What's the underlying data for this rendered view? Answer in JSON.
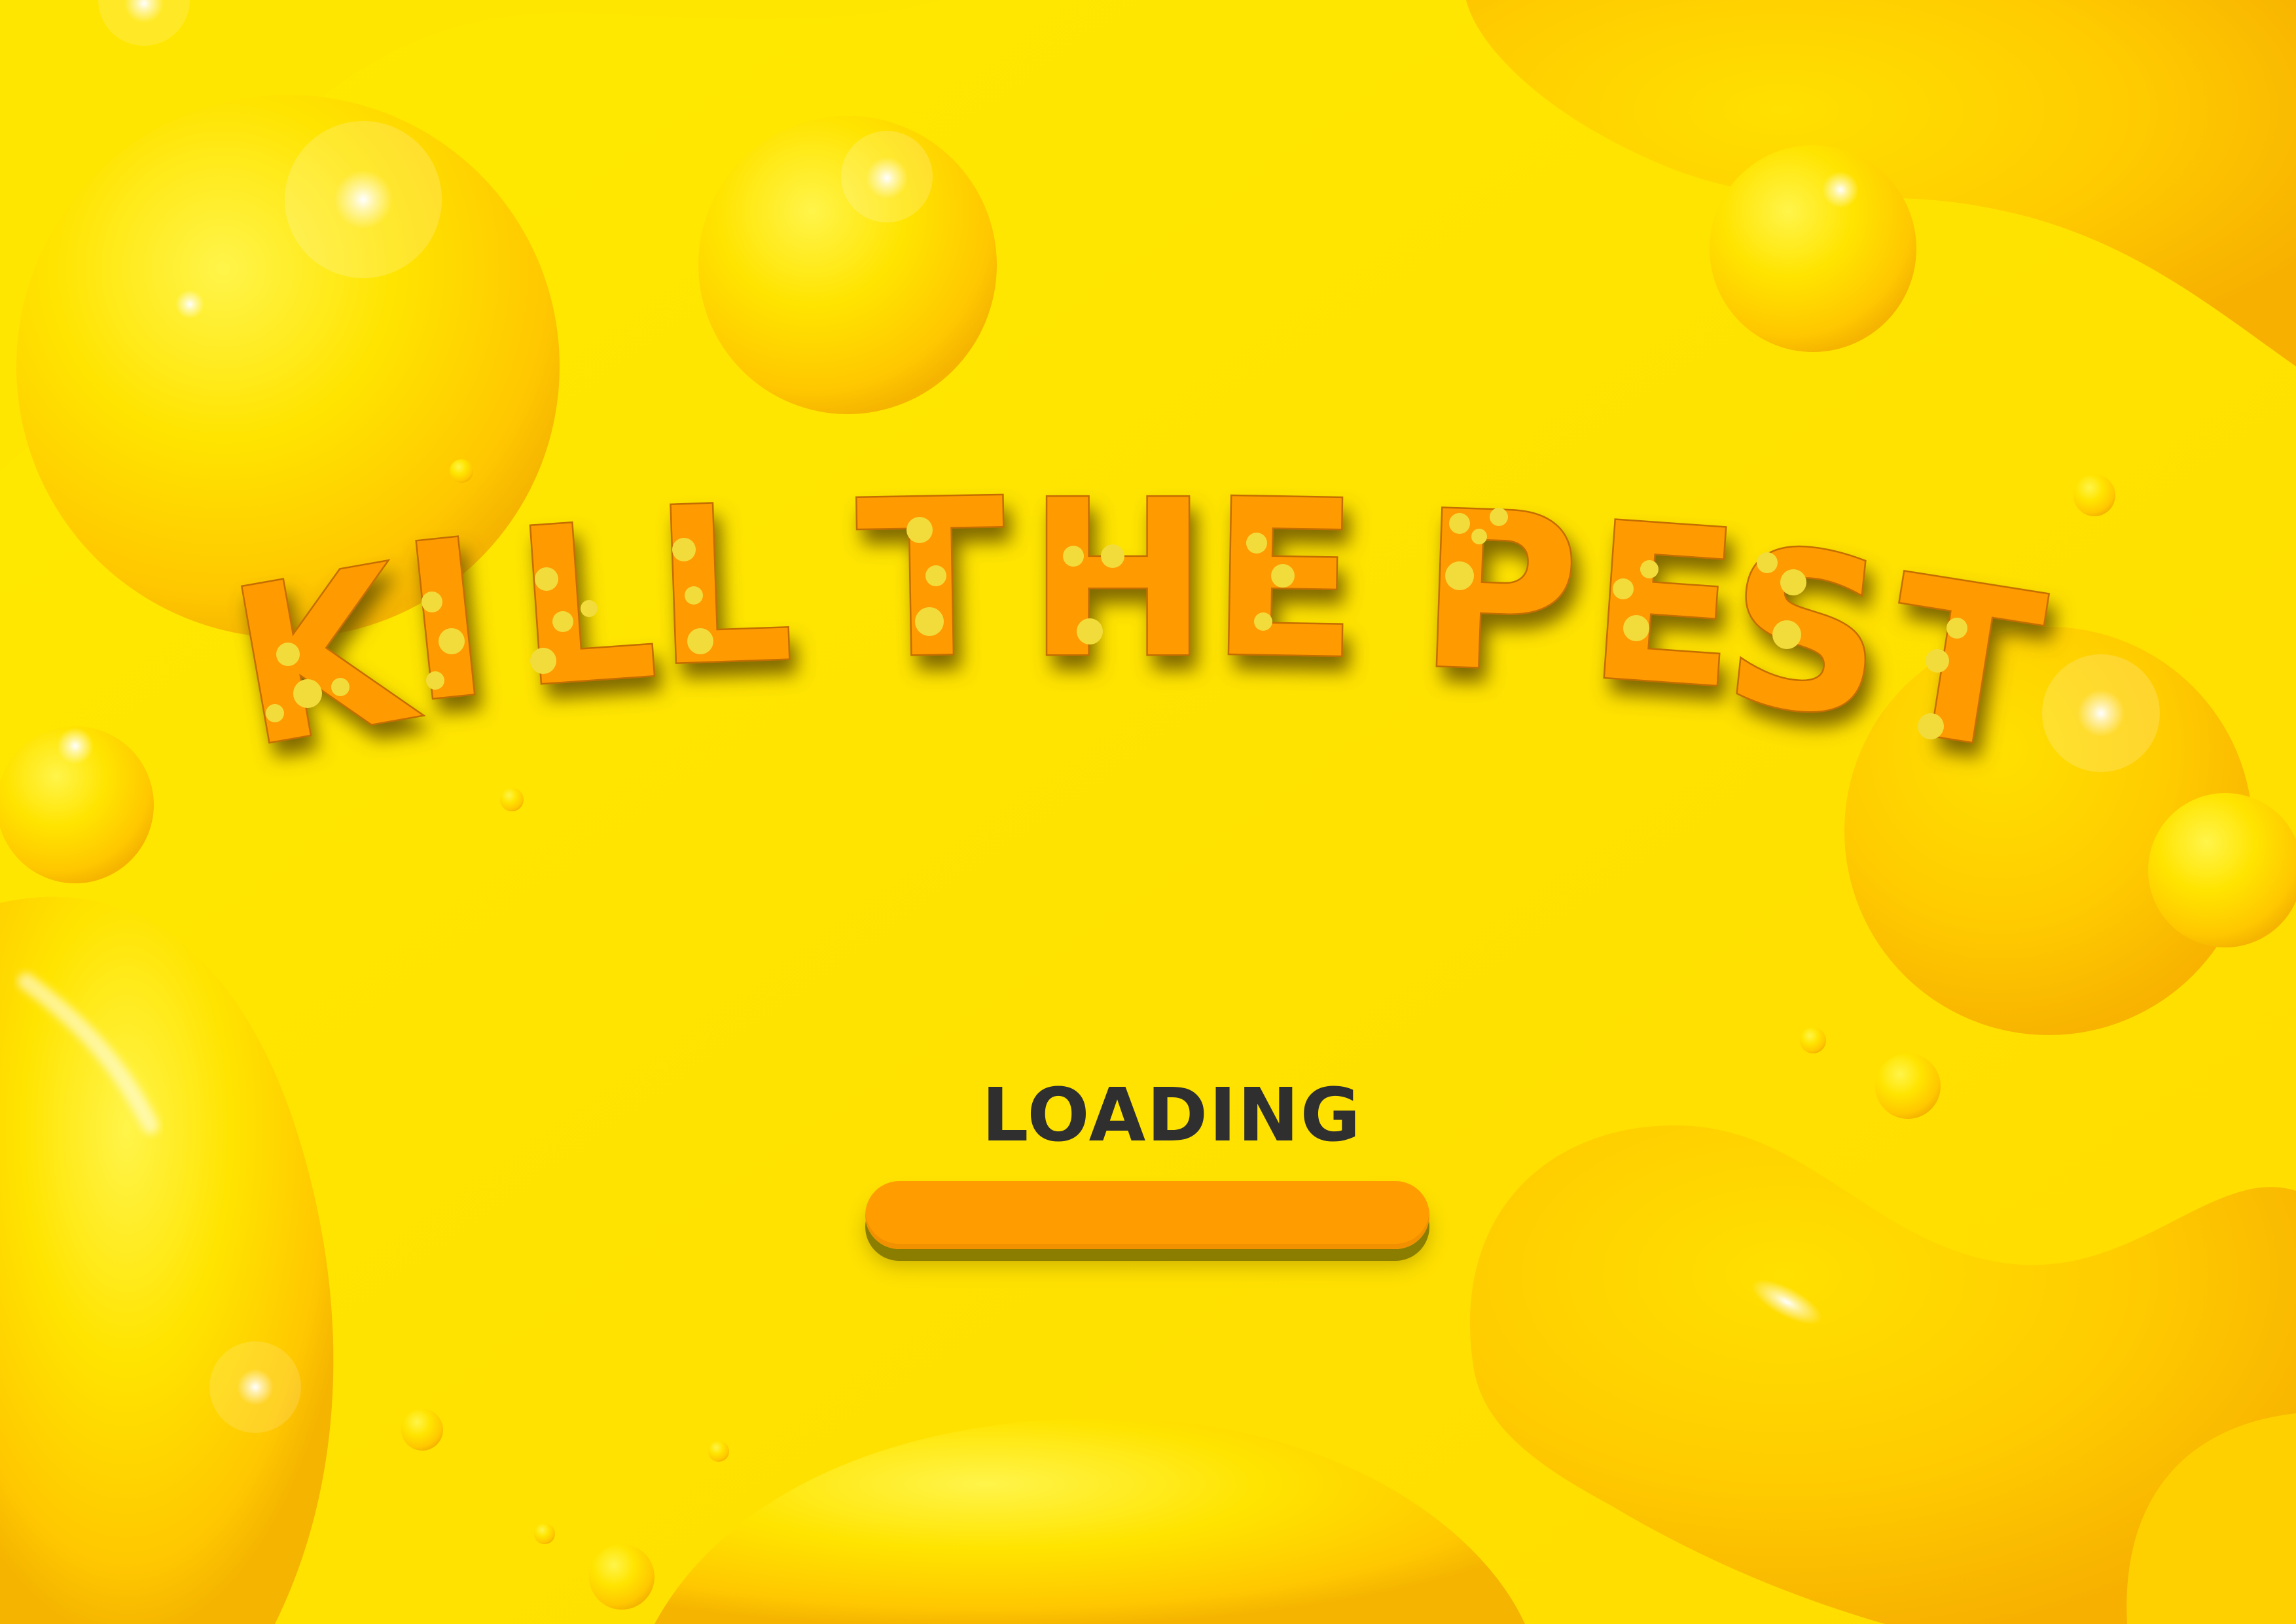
{
  "game": {
    "title_words": [
      "KILL",
      "THE",
      "PEST"
    ],
    "loading_label": "LOADING",
    "progress": 1.0
  },
  "colors": {
    "background": "#ffe000",
    "title_fill": "#ff9a00",
    "title_spots": "#f2dc3c",
    "title_shadow": "#7a6200",
    "progress_fill": "#ff9d00",
    "loading_text": "#2f2f30"
  }
}
